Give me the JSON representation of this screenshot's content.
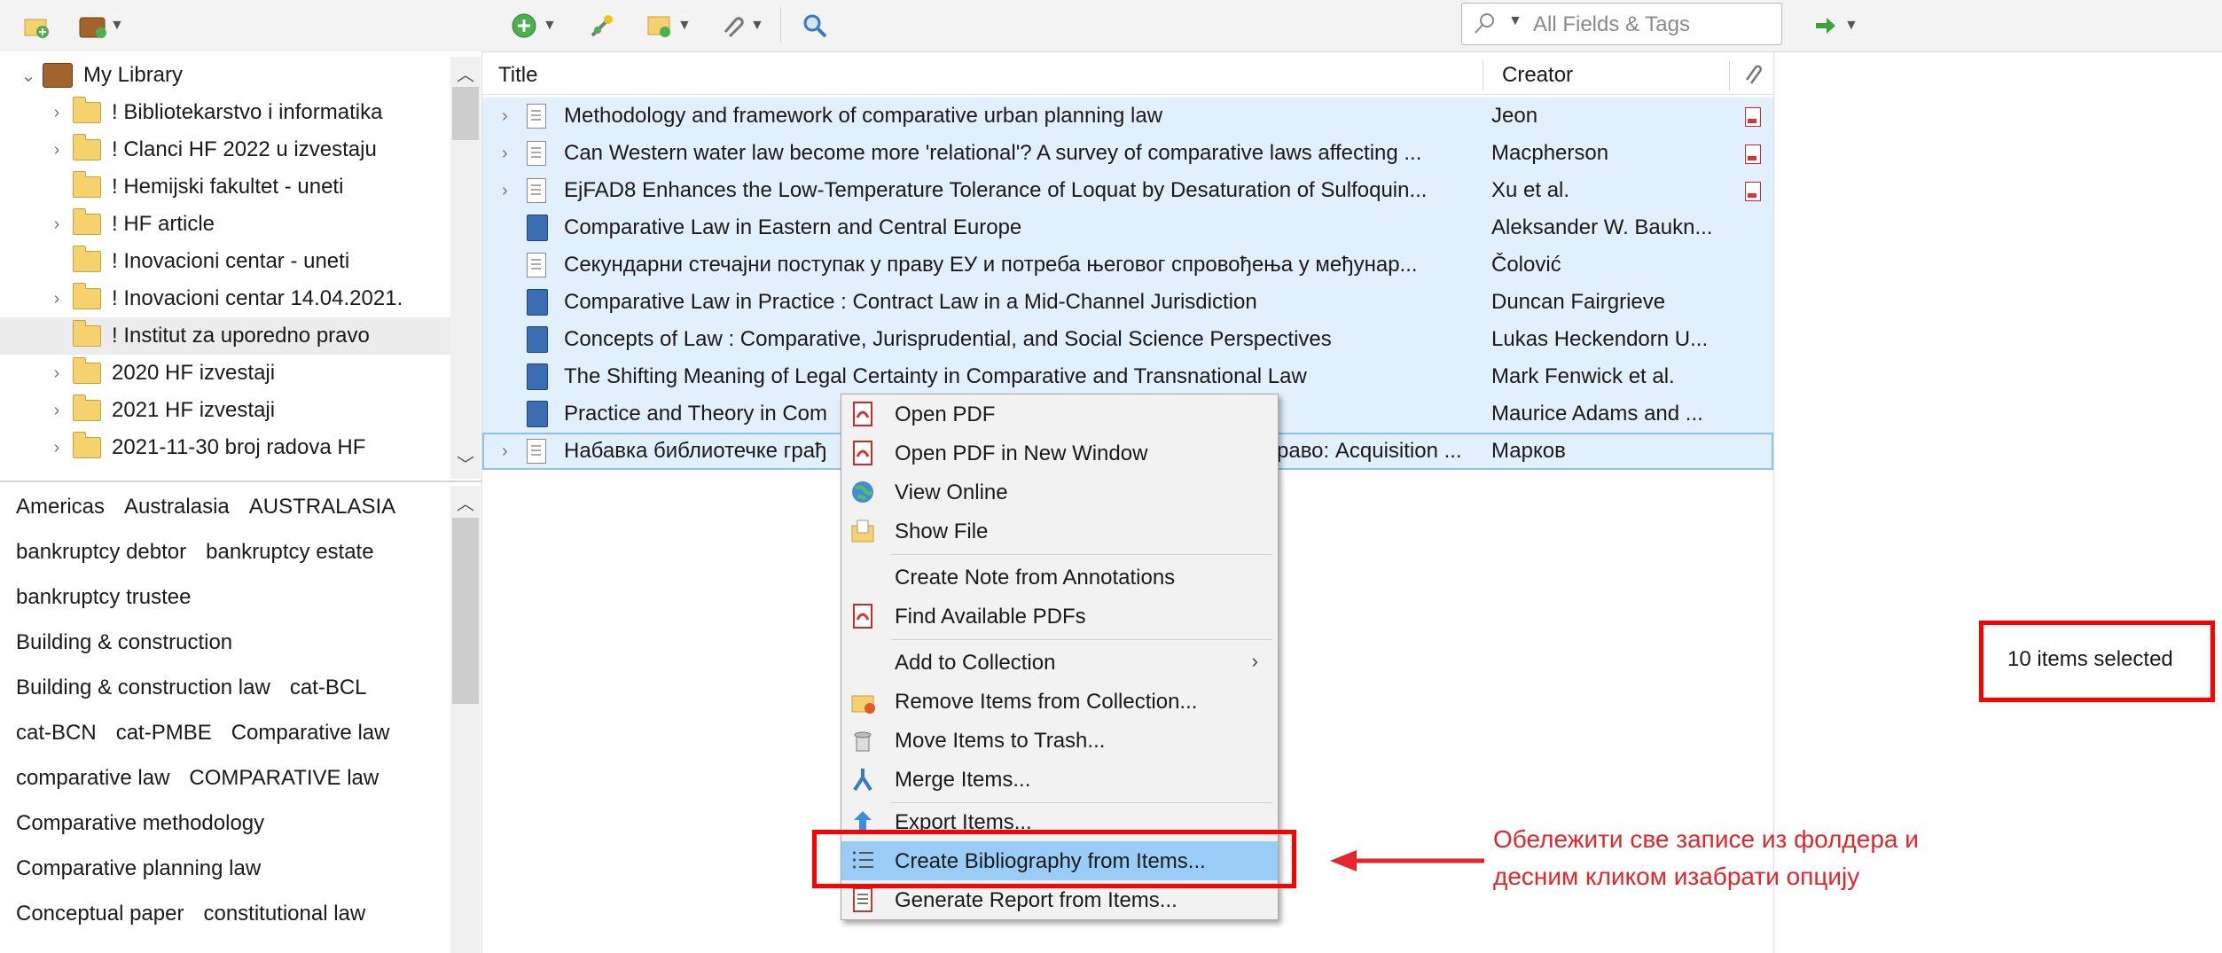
{
  "toolbar": {
    "search_placeholder": "All Fields & Tags",
    "icons": [
      "new-collection-icon",
      "new-library-icon",
      "new-item-icon",
      "add-by-identifier-icon",
      "new-note-icon",
      "attachment-icon",
      "advanced-search-icon",
      "sync-icon"
    ]
  },
  "collections": {
    "items": [
      {
        "label": "My Library",
        "expanded": true
      },
      {
        "label": "! Bibliotekarstvo i informatika",
        "twisty": true
      },
      {
        "label": "! Clanci HF 2022 u izvestaju",
        "twisty": true
      },
      {
        "label": "! Hemijski fakultet - uneti",
        "twisty": false
      },
      {
        "label": "! HF article",
        "twisty": true
      },
      {
        "label": "! Inovacioni centar - uneti",
        "twisty": false
      },
      {
        "label": "! Inovacioni centar 14.04.2021.",
        "twisty": true
      },
      {
        "label": "! Institut za uporedno pravo",
        "twisty": false,
        "selected": true
      },
      {
        "label": "2020 HF izvestaji",
        "twisty": true
      },
      {
        "label": "2021 HF izvestaji",
        "twisty": true
      },
      {
        "label": "2021-11-30 broj radova HF",
        "twisty": true
      }
    ]
  },
  "tags": {
    "lines": [
      [
        "Americas",
        "Australasia",
        "AUSTRALASIA"
      ],
      [
        "bankruptcy debtor",
        "bankruptcy estate"
      ],
      [
        "bankruptcy trustee"
      ],
      [
        "Building & construction"
      ],
      [
        "Building & construction law",
        "cat-BCL"
      ],
      [
        "cat-BCN",
        "cat-PMBE",
        "Comparative law"
      ],
      [
        "comparative law",
        "COMPARATIVE law"
      ],
      [
        "Comparative methodology"
      ],
      [
        "Comparative planning law"
      ],
      [
        "Conceptual paper",
        "constitutional law"
      ]
    ]
  },
  "items_header": {
    "title": "Title",
    "creator": "Creator"
  },
  "items": [
    {
      "title": "Methodology and framework of comparative urban planning law",
      "creator": "Jeon",
      "type": "doc",
      "twisty": true,
      "pdf": true
    },
    {
      "title": "Can Western water law become more 'relational'? A survey of comparative laws affecting ...",
      "creator": "Macpherson",
      "type": "doc",
      "twisty": true,
      "pdf": true
    },
    {
      "title": "EjFAD8 Enhances the Low-Temperature Tolerance of Loquat by Desaturation of Sulfoquin...",
      "creator": "Xu et al.",
      "type": "doc",
      "twisty": true,
      "pdf": true
    },
    {
      "title": "Comparative Law in Eastern and Central Europe",
      "creator": "Aleksander W. Baukn...",
      "type": "book",
      "twisty": false,
      "pdf": false
    },
    {
      "title": "Секундарни стечајни поступак у праву ЕУ и потреба његовог спровођења у међунар...",
      "creator": "Čolović",
      "type": "doc",
      "twisty": false,
      "pdf": false
    },
    {
      "title": "Comparative Law in Practice : Contract Law in a Mid-Channel Jurisdiction",
      "creator": "Duncan Fairgrieve",
      "type": "book",
      "twisty": false,
      "pdf": false
    },
    {
      "title": "Concepts of Law : Comparative, Jurisprudential, and Social Science Perspectives",
      "creator": "Lukas Heckendorn U...",
      "type": "book",
      "twisty": false,
      "pdf": false
    },
    {
      "title": "The Shifting Meaning of Legal Certainty in Comparative and Transnational Law",
      "creator": "Mark Fenwick et al.",
      "type": "book",
      "twisty": false,
      "pdf": false
    },
    {
      "title": "Practice and Theory in Com",
      "creator": "Maurice Adams and ...",
      "type": "book",
      "twisty": false,
      "pdf": false
    },
    {
      "title": "Набавка библиотечке грађ",
      "title_tail": "раво: Acquisition ...",
      "creator": "Марков",
      "type": "doc",
      "twisty": true,
      "pdf": false,
      "focus": true
    }
  ],
  "context_menu": {
    "items": [
      {
        "label": "Open PDF",
        "icon": "pdf-icon"
      },
      {
        "label": "Open PDF in New Window",
        "icon": "pdf-icon"
      },
      {
        "label": "View Online",
        "icon": "globe-icon"
      },
      {
        "label": "Show File",
        "icon": "folder-icon"
      },
      {
        "label": "Create Note from Annotations",
        "icon": ""
      },
      {
        "label": "Find Available PDFs",
        "icon": "pdf-icon"
      },
      {
        "label": "Add to Collection",
        "icon": "",
        "submenu": true
      },
      {
        "label": "Remove Items from Collection...",
        "icon": "folder-remove-icon"
      },
      {
        "label": "Move Items to Trash...",
        "icon": "trash-icon"
      },
      {
        "label": "Merge Items...",
        "icon": "merge-icon"
      },
      {
        "label": "Export Items...",
        "icon": "export-icon"
      },
      {
        "label": "Create Bibliography from Items...",
        "icon": "bibliography-icon",
        "highlight": true
      },
      {
        "label": "Generate Report from Items...",
        "icon": "report-icon"
      }
    ]
  },
  "item_pane": {
    "status": "10 items selected"
  },
  "annotation": {
    "line1": "Обележити све записе из фолдера и",
    "line2": "десним кликом изабрати опцију",
    "color": "#e3262a"
  },
  "colors": {
    "selection": "#e1f0fc",
    "menu_highlight": "#99ccf6",
    "annotation_red": "#ff0000"
  }
}
